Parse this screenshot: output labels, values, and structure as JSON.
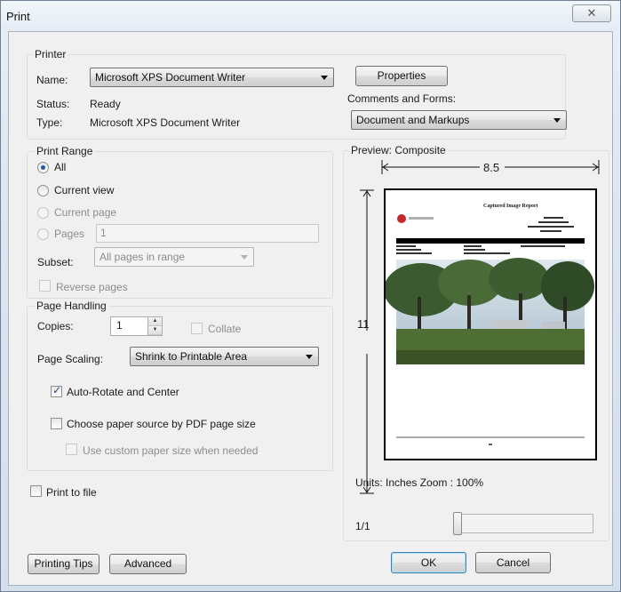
{
  "window": {
    "title": "Print"
  },
  "printer": {
    "legend": "Printer",
    "name_label": "Name:",
    "name_value": "Microsoft XPS Document Writer",
    "properties_label": "Properties",
    "status_label": "Status:",
    "status_value": "Ready",
    "type_label": "Type:",
    "type_value": "Microsoft XPS Document Writer",
    "comments_label": "Comments and Forms:",
    "comments_value": "Document and Markups"
  },
  "print_range": {
    "legend": "Print Range",
    "all_label": "All",
    "current_view_label": "Current view",
    "current_page_label": "Current page",
    "pages_label": "Pages",
    "pages_value": "1",
    "subset_label": "Subset:",
    "subset_value": "All pages in range",
    "reverse_label": "Reverse pages"
  },
  "page_handling": {
    "legend": "Page Handling",
    "copies_label": "Copies:",
    "copies_value": "1",
    "collate_label": "Collate",
    "scaling_label": "Page Scaling:",
    "scaling_value": "Shrink to Printable Area",
    "auto_rotate_label": "Auto-Rotate and Center",
    "choose_source_label": "Choose paper source by PDF page size",
    "custom_size_label": "Use custom paper size when needed"
  },
  "print_to_file_label": "Print to file",
  "preview": {
    "legend": "Preview: Composite",
    "width_label": "8.5",
    "height_label": "11",
    "doc_title": "Captured Image Report",
    "units_label": "Units: Inches Zoom : 100%",
    "page_indicator": "1/1"
  },
  "buttons": {
    "printing_tips": "Printing Tips",
    "advanced": "Advanced",
    "ok": "OK",
    "cancel": "Cancel"
  },
  "icons": {
    "close": "close-icon",
    "dropdown": "chevron-down-icon",
    "spin_up": "spin-up-icon",
    "spin_down": "spin-down-icon",
    "arrow_left": "arrow-left-icon",
    "arrow_right": "arrow-right-icon"
  }
}
